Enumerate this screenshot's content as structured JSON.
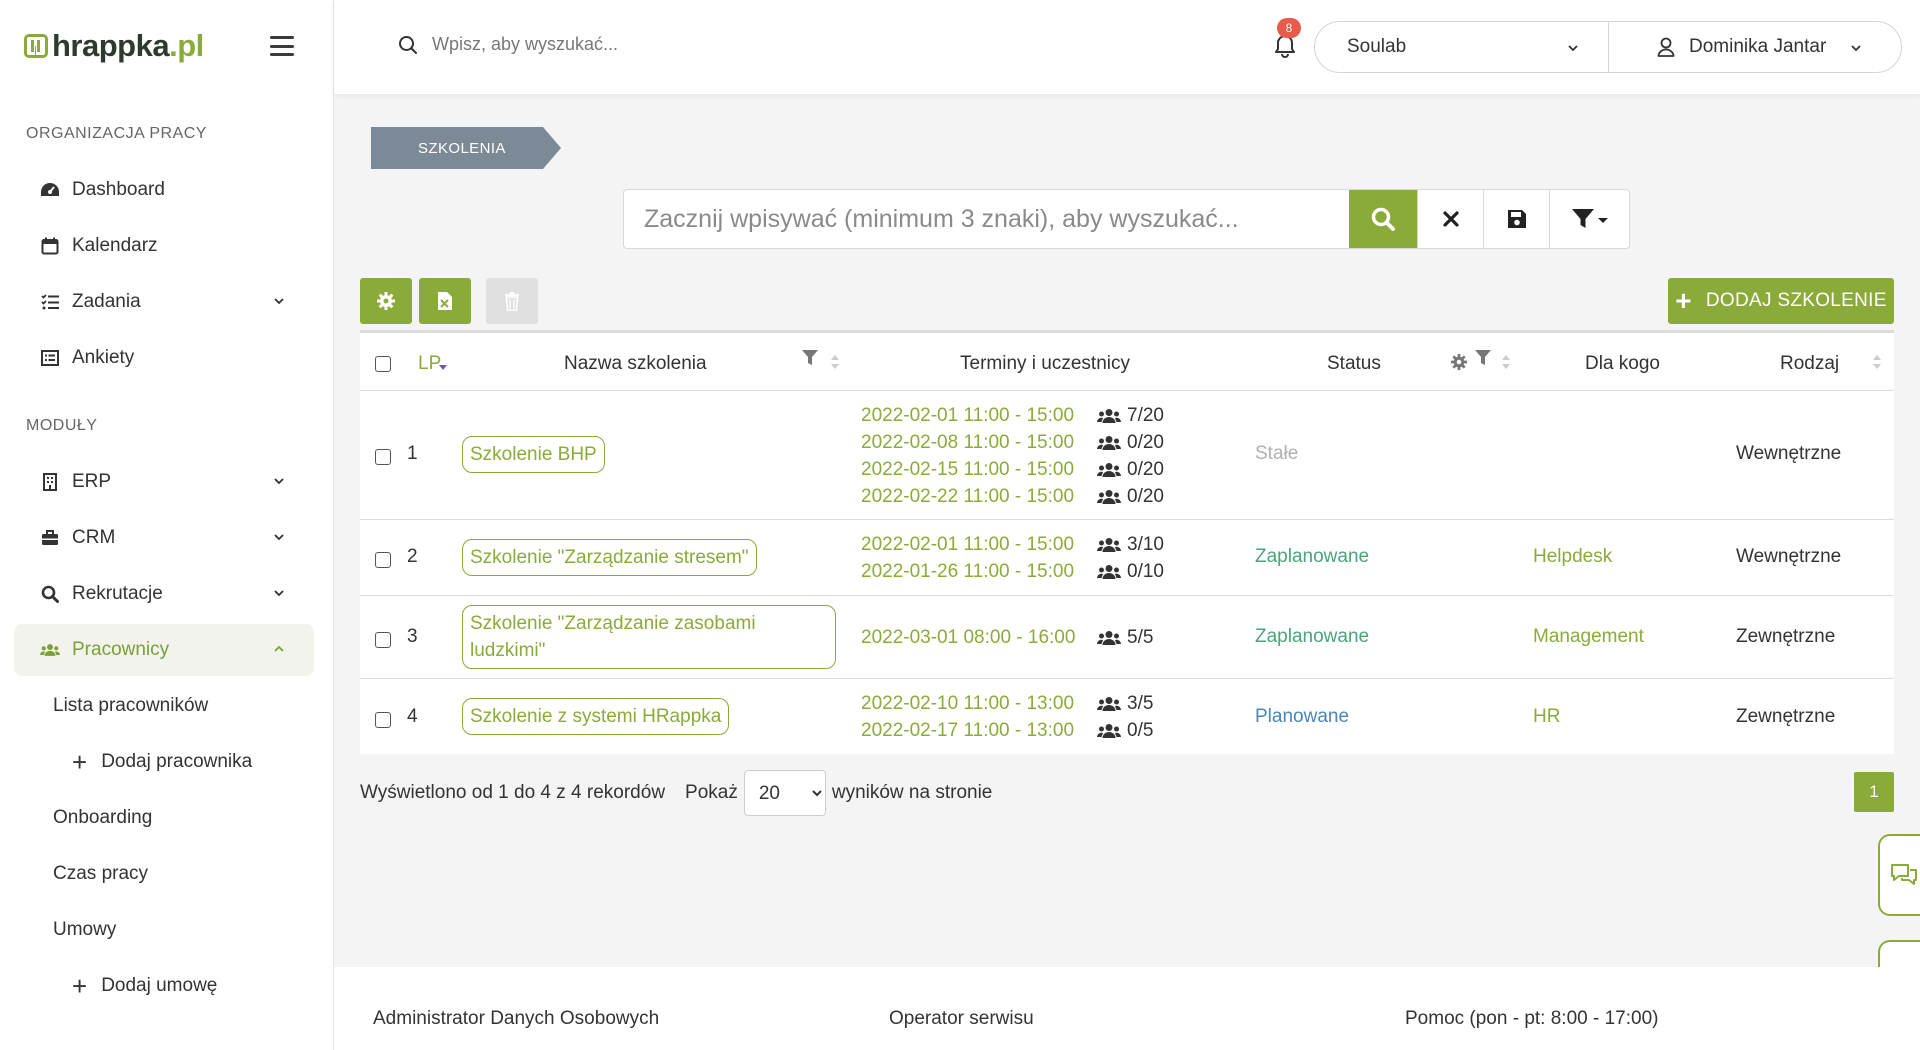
{
  "app": {
    "logo_text_main": "hrappka",
    "logo_text_tld": ".pl",
    "accent_color": "#8aab3a"
  },
  "sidebar": {
    "section_org": "ORGANIZACJA PRACY",
    "section_modules": "MODUŁY",
    "items": [
      {
        "label": "Dashboard",
        "icon": "dashboard-icon"
      },
      {
        "label": "Kalendarz",
        "icon": "calendar-icon"
      },
      {
        "label": "Zadania",
        "icon": "tasks-icon"
      },
      {
        "label": "Ankiety",
        "icon": "survey-icon"
      },
      {
        "label": "ERP",
        "icon": "building-icon"
      },
      {
        "label": "CRM",
        "icon": "briefcase-icon"
      },
      {
        "label": "Rekrutacje",
        "icon": "search-icon"
      },
      {
        "label": "Pracownicy",
        "icon": "users-icon"
      }
    ],
    "sub_items": [
      {
        "label": "Lista pracowników"
      },
      {
        "label": "Dodaj pracownika"
      },
      {
        "label": "Onboarding"
      },
      {
        "label": "Czas pracy"
      },
      {
        "label": "Umowy"
      },
      {
        "label": "Dodaj umowę"
      }
    ]
  },
  "topbar": {
    "search_placeholder": "Wpisz, aby wyszukać...",
    "notifications_count": "8",
    "company": "Soulab",
    "user": "Dominika Jantar"
  },
  "breadcrumb": "SZKOLENIA",
  "main_search": {
    "placeholder": "Zacznij wpisywać (minimum 3 znaki), aby wyszukać..."
  },
  "toolbar": {
    "add_label": "DODAJ SZKOLENIE"
  },
  "table": {
    "headers": {
      "lp": "LP",
      "name": "Nazwa szkolenia",
      "terms": "Terminy i uczestnicy",
      "status": "Status",
      "for_whom": "Dla kogo",
      "type": "Rodzaj"
    },
    "rows": [
      {
        "lp": "1",
        "name": "Szkolenie BHP",
        "dates": [
          "2022-02-01 11:00 - 15:00",
          "2022-02-08 11:00 - 15:00",
          "2022-02-15 11:00 - 15:00",
          "2022-02-22 11:00 - 15:00"
        ],
        "counts": [
          "7/20",
          "0/20",
          "0/20",
          "0/20"
        ],
        "status": "Stałe",
        "status_color": "#b0b0b0",
        "for_whom": "",
        "type": "Wewnętrzne"
      },
      {
        "lp": "2",
        "name": "Szkolenie \"Zarządzanie stresem\"",
        "dates": [
          "2022-02-01 11:00 - 15:00",
          "2022-01-26 11:00 - 15:00"
        ],
        "counts": [
          "3/10",
          "0/10"
        ],
        "status": "Zaplanowane",
        "status_color": "#4aa37a",
        "for_whom": "Helpdesk",
        "type": "Wewnętrzne"
      },
      {
        "lp": "3",
        "name": "Szkolenie \"Zarządzanie zasobami ludzkimi\"",
        "dates": [
          "2022-03-01 08:00 - 16:00"
        ],
        "counts": [
          "5/5"
        ],
        "status": "Zaplanowane",
        "status_color": "#4aa37a",
        "for_whom": "Management",
        "type": "Zewnętrzne"
      },
      {
        "lp": "4",
        "name": "Szkolenie z systemi HRappka",
        "dates": [
          "2022-02-10 11:00 - 13:00",
          "2022-02-17 11:00 - 13:00"
        ],
        "counts": [
          "3/5",
          "0/5"
        ],
        "status": "Planowane",
        "status_color": "#4a86b8",
        "for_whom": "HR",
        "type": "Zewnętrzne"
      }
    ]
  },
  "pager": {
    "summary": "Wyświetlono od 1 do 4 z 4 rekordów",
    "show_label": "Pokaż",
    "page_size": "20",
    "per_page_label": "wyników na stronie",
    "current_page": "1"
  },
  "footer": {
    "col1": "Administrator Danych Osobowych",
    "col2": "Operator serwisu",
    "col3": "Pomoc (pon - pt: 8:00 - 17:00)"
  }
}
